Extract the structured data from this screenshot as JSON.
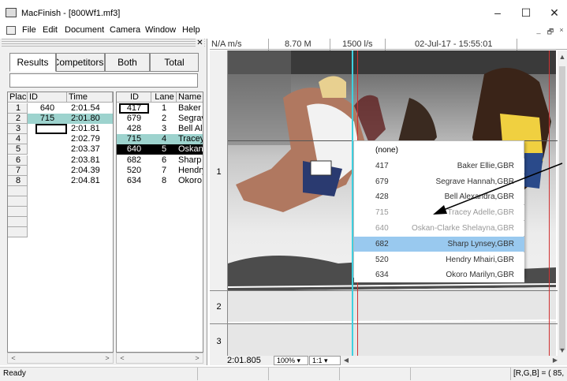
{
  "window": {
    "title": "MacFinish - [800Wf1.mf3]",
    "minimize": "–",
    "maximize": "☐",
    "close": "✕"
  },
  "menu": {
    "items": [
      "File",
      "Edit",
      "Document",
      "Camera",
      "Window",
      "Help"
    ],
    "mdi": [
      "_",
      "🗗",
      "×"
    ]
  },
  "tabs": {
    "results": "Results",
    "competitors": "Competitors",
    "both": "Both",
    "total": "Total"
  },
  "panel": {
    "close": "✕"
  },
  "results": {
    "headers": [
      "Place",
      "ID",
      "Time"
    ],
    "rows": [
      [
        "1",
        "640",
        "2:01.54"
      ],
      [
        "2",
        "715",
        "2:01.80"
      ],
      [
        "3",
        "",
        "2:01.81"
      ],
      [
        "4",
        "",
        "2:02.79"
      ],
      [
        "5",
        "",
        "2:03.37"
      ],
      [
        "6",
        "",
        "2:03.81"
      ],
      [
        "7",
        "",
        "2:04.39"
      ],
      [
        "8",
        "",
        "2:04.81"
      ]
    ]
  },
  "competitors": {
    "headers": [
      "ID",
      "Lane",
      "Name"
    ],
    "rows": [
      [
        "417",
        "1",
        "Baker Ellie,GBR"
      ],
      [
        "679",
        "2",
        "Segrave Hannah,GBR"
      ],
      [
        "428",
        "3",
        "Bell Alexandra,GBR"
      ],
      [
        "715",
        "4",
        "Tracey Adelle,GBR"
      ],
      [
        "640",
        "5",
        "Oskan-Clarke Shelayna,GBR"
      ],
      [
        "682",
        "6",
        "Sharp Lynsey,GBR"
      ],
      [
        "520",
        "7",
        "Hendry Mhairi,GBR"
      ],
      [
        "634",
        "8",
        "Okoro Marilyn,GBR"
      ]
    ]
  },
  "image": {
    "speed": "N/A m/s",
    "distance": "8.70 M",
    "rate": "1500 l/s",
    "datetime": "02-Jul-17 - 15:55:01",
    "time": "2:01.805",
    "zoom": "100%",
    "ratio": "1:1",
    "lanes": [
      "1",
      "2",
      "3"
    ]
  },
  "popup": {
    "none": "(none)",
    "items": [
      {
        "id": "417",
        "name": "Baker Ellie,GBR",
        "state": "normal"
      },
      {
        "id": "679",
        "name": "Segrave Hannah,GBR",
        "state": "normal"
      },
      {
        "id": "428",
        "name": "Bell Alexandra,GBR",
        "state": "normal"
      },
      {
        "id": "715",
        "name": "Tracey Adelle,GBR",
        "state": "disabled"
      },
      {
        "id": "640",
        "name": "Oskan-Clarke Shelayna,GBR",
        "state": "disabled"
      },
      {
        "id": "682",
        "name": "Sharp Lynsey,GBR",
        "state": "selected"
      },
      {
        "id": "520",
        "name": "Hendry Mhairi,GBR",
        "state": "normal"
      },
      {
        "id": "634",
        "name": "Okoro Marilyn,GBR",
        "state": "normal"
      }
    ]
  },
  "status": {
    "left": "Ready",
    "right": "[R,G,B] = ( 85,"
  },
  "colors": {
    "highlight": "#9dd3ce",
    "selected": "#99c9ef",
    "black_row": "#000000",
    "finish_line": "#e04040",
    "cyan_line": "#3fd0e0"
  }
}
